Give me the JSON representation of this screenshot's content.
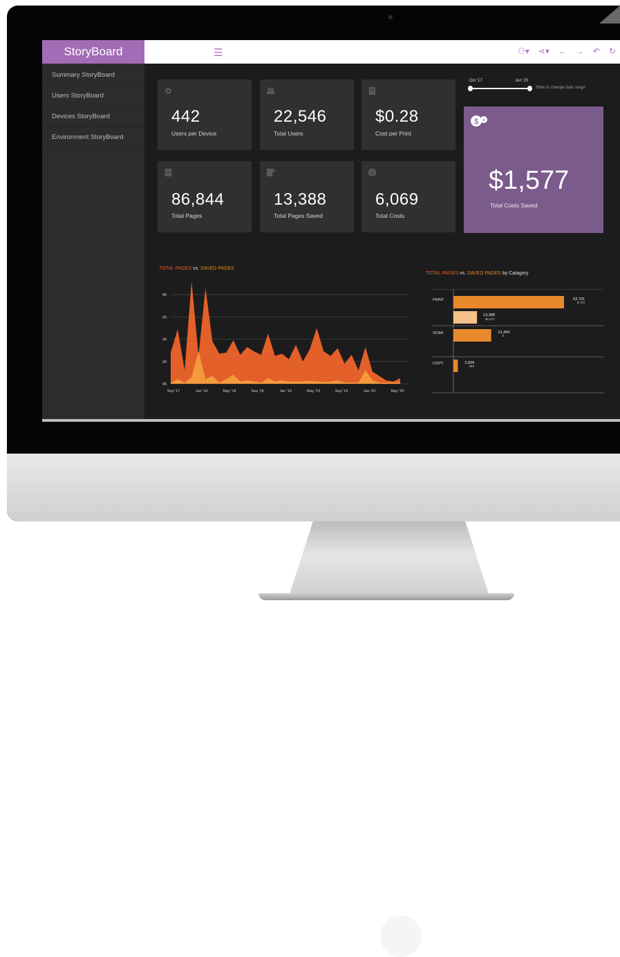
{
  "app": {
    "brand": "StoryBoard",
    "menu_icon": "hamburger-icon"
  },
  "toolbar": {
    "icons": [
      "user-dropdown-icon",
      "share-icon",
      "back-arrow-icon",
      "forward-arrow-icon",
      "undo-icon",
      "refresh-icon"
    ]
  },
  "sidebar": {
    "items": [
      {
        "label": "Summary StoryBoard"
      },
      {
        "label": "Users StoryBoard"
      },
      {
        "label": "Devices StoryBoard"
      },
      {
        "label": "Environment StoryBoard"
      }
    ]
  },
  "cards": [
    {
      "value": "442",
      "label": "Users per Device",
      "icon": "gear-icon"
    },
    {
      "value": "22,546",
      "label": "Total Users",
      "icon": "users-icon"
    },
    {
      "value": "$0.28",
      "label": "Cost per Print",
      "icon": "receipt-icon"
    },
    {
      "value": "86,844",
      "label": "Total Pages",
      "icon": "document-icon"
    },
    {
      "value": "13,388",
      "label": "Total Pages Saved",
      "icon": "document-saved-icon"
    },
    {
      "value": "6,069",
      "label": "Total Costs",
      "icon": "dollar-icon"
    }
  ],
  "highlight": {
    "value": "$1,577",
    "label": "Total Costs Saved",
    "icon": "dollar-plus-icon"
  },
  "date_range": {
    "start": "Oct '17",
    "end": "Jun '20",
    "hint": "Slide to change date range"
  },
  "colors": {
    "accent": "#a36cb6",
    "total": "#e4602a",
    "saved": "#f59a3c",
    "highlight": "#7b5a8c"
  },
  "chart_data": [
    {
      "type": "area",
      "title": "TOTAL PAGES vs. SAVED PAGES",
      "title_parts": [
        "TOTAL PAGES",
        " vs. ",
        "SAVED PAGES"
      ],
      "y_ticks": [
        "0K",
        "2K",
        "4K",
        "6K",
        "8K"
      ],
      "ylim": [
        0,
        9000
      ],
      "x_ticks": [
        "Sep '17",
        "Jan '18",
        "May '18",
        "Sep '18",
        "Jan '19",
        "May '19",
        "Sep '19",
        "Jan '20",
        "May '20"
      ],
      "grid": true,
      "series": [
        {
          "name": "TOTAL PAGES",
          "values": [
            2800,
            4900,
            1200,
            9200,
            2500,
            8600,
            3800,
            2700,
            2800,
            3900,
            2600,
            3300,
            2900,
            2600,
            4500,
            2500,
            2700,
            2200,
            3500,
            2000,
            3100,
            5000,
            2900,
            2500,
            3200,
            1800,
            2600,
            1200,
            3300,
            1100,
            700,
            300,
            200,
            500
          ]
        },
        {
          "name": "SAVED PAGES",
          "values": [
            100,
            400,
            100,
            600,
            2900,
            400,
            700,
            100,
            400,
            800,
            200,
            300,
            200,
            100,
            500,
            200,
            300,
            200,
            200,
            200,
            250,
            200,
            150,
            200,
            300,
            100,
            100,
            100,
            1200,
            300,
            100,
            100,
            100,
            100
          ]
        }
      ]
    },
    {
      "type": "bar",
      "title": "TOTAL PAGES vs. SAVED PAGES by Catagory",
      "title_parts": [
        "TOTAL PAGES",
        " vs. ",
        "SAVED PAGES",
        " by Catagory"
      ],
      "categories": [
        "PRINT",
        "SCAN",
        "COPY"
      ],
      "series": [
        {
          "name": "TOTAL PAGES",
          "values": [
            62791,
            21454,
            2509
          ],
          "sub": [
            "5,744",
            "0",
            "325"
          ]
        },
        {
          "name": "SAVED PAGES",
          "values": [
            13388,
            null,
            null
          ],
          "sub": [
            "$1,577",
            "",
            ""
          ]
        }
      ],
      "labels": {
        "print_total": "62,791",
        "print_saved": "13,388",
        "scan_total": "21,454",
        "copy_total": "2,509"
      }
    }
  ]
}
